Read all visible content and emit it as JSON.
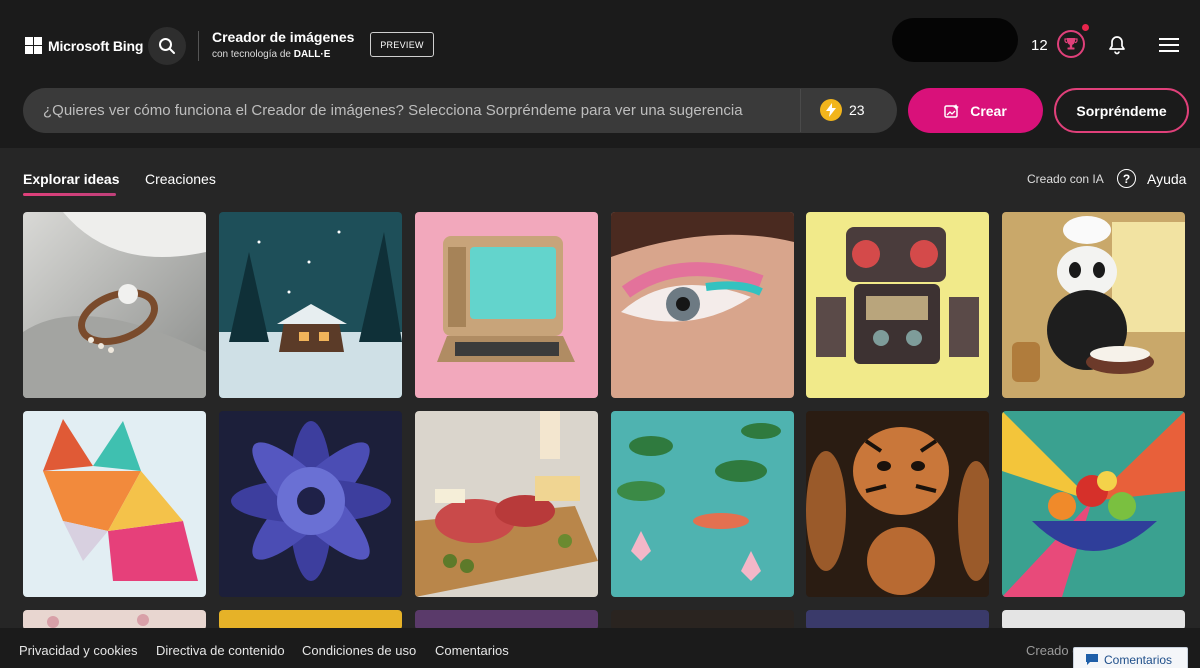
{
  "header": {
    "brand": "Microsoft Bing",
    "app_title": "Creador de imágenes",
    "app_subtitle_prefix": "con tecnología de",
    "app_subtitle_tech": "DALL·E",
    "preview_badge": "PREVIEW",
    "rewards_count": "12"
  },
  "prompt": {
    "placeholder": "¿Quieres ver cómo funciona el Creador de imágenes? Selecciona Sorpréndeme para ver una sugerencia",
    "boosts_count": "23",
    "create_label": "Crear",
    "surprise_label": "Sorpréndeme"
  },
  "tabs": [
    {
      "label": "Explorar ideas",
      "active": true
    },
    {
      "label": "Creaciones",
      "active": false
    }
  ],
  "right_links": {
    "made_with_ai": "Creado con IA",
    "help": "Ayuda"
  },
  "gallery": {
    "row1": [
      {
        "icon": "pearl-ring-image"
      },
      {
        "icon": "snowy-cabin-image"
      },
      {
        "icon": "retro-computer-image"
      },
      {
        "icon": "eye-makeup-image"
      },
      {
        "icon": "robot-image"
      },
      {
        "icon": "panda-chef-image"
      }
    ],
    "row2": [
      {
        "icon": "paper-fox-image"
      },
      {
        "icon": "blue-dahlia-image"
      },
      {
        "icon": "charcuterie-board-image"
      },
      {
        "icon": "koi-pond-image"
      },
      {
        "icon": "tiger-figurines-image"
      },
      {
        "icon": "fruit-bowl-image"
      }
    ]
  },
  "footer": {
    "links": [
      "Privacidad y cookies",
      "Directiva de contenido",
      "Condiciones de uso",
      "Comentarios"
    ],
    "faded_text": "Creado c",
    "feedback_button": "Comentarios"
  },
  "colors": {
    "accent_pink": "#d9117a",
    "header_bg": "#1b1b1b",
    "page_bg": "#262626",
    "boost_yellow": "#f2b51c"
  }
}
